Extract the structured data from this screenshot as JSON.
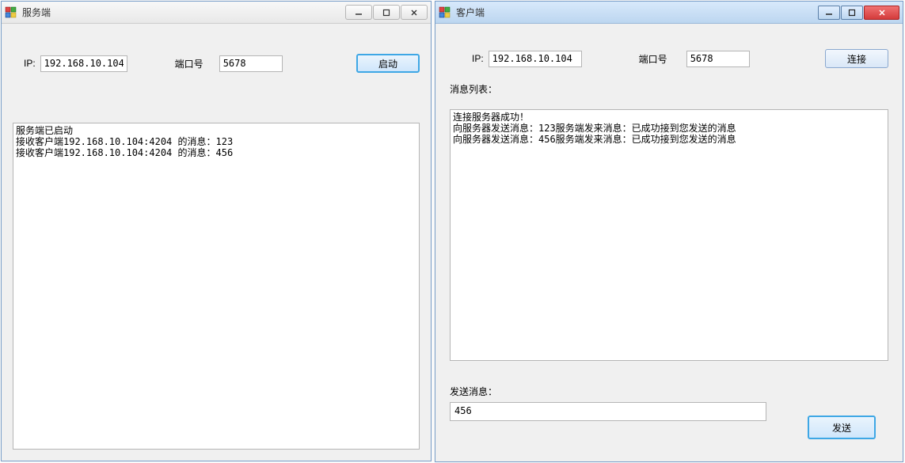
{
  "server": {
    "title": "服务端",
    "ip_label": "IP:",
    "ip_value": "192.168.10.104",
    "port_label": "端口号",
    "port_value": "5678",
    "start_btn": "启动",
    "log": "服务端已启动\n接收客户端192.168.10.104:4204 的消息：123\n接收客户端192.168.10.104:4204 的消息：456"
  },
  "client": {
    "title": "客户端",
    "ip_label": "IP:",
    "ip_value": "192.168.10.104",
    "port_label": "端口号",
    "port_value": "5678",
    "connect_btn": "连接",
    "msglist_label": "消息列表：",
    "msglist": "连接服务器成功！\n向服务器发送消息：123服务端发来消息：已成功接到您发送的消息\n向服务器发送消息：456服务端发来消息：已成功接到您发送的消息",
    "send_label": "发送消息：",
    "send_value": "456",
    "send_btn": "发送"
  }
}
